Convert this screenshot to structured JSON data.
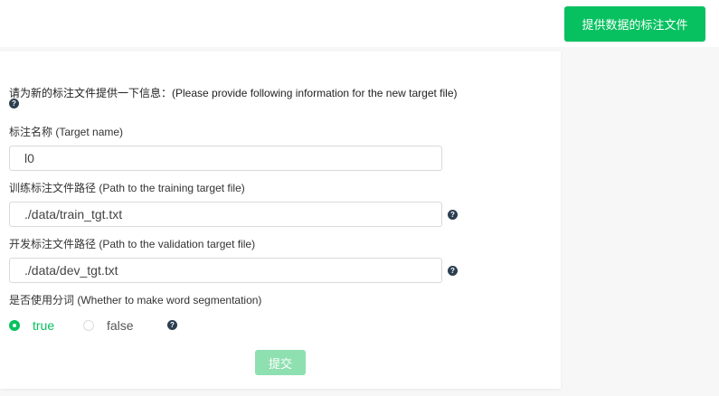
{
  "header": {
    "provide_button_label": "提供数据的标注文件"
  },
  "form": {
    "intro": "请为新的标注文件提供一下信息：(Please provide following information for the new target file)",
    "target_name": {
      "label": "标注名称 (Target name)",
      "value": "l0"
    },
    "train_path": {
      "label": "训练标注文件路径 (Path to the training target file)",
      "value": "./data/train_tgt.txt"
    },
    "dev_path": {
      "label": "开发标注文件路径 (Path to the validation target file)",
      "value": "./data/dev_tgt.txt"
    },
    "segmentation": {
      "label": "是否使用分词 (Whether to make word segmentation)",
      "options": [
        "true",
        "false"
      ],
      "selected": "true"
    },
    "submit_label": "提交",
    "help_glyph": "?"
  },
  "colors": {
    "accent": "#07c160",
    "submit_disabled": "#8ee0b0",
    "help_icon": "#2c3e50"
  }
}
